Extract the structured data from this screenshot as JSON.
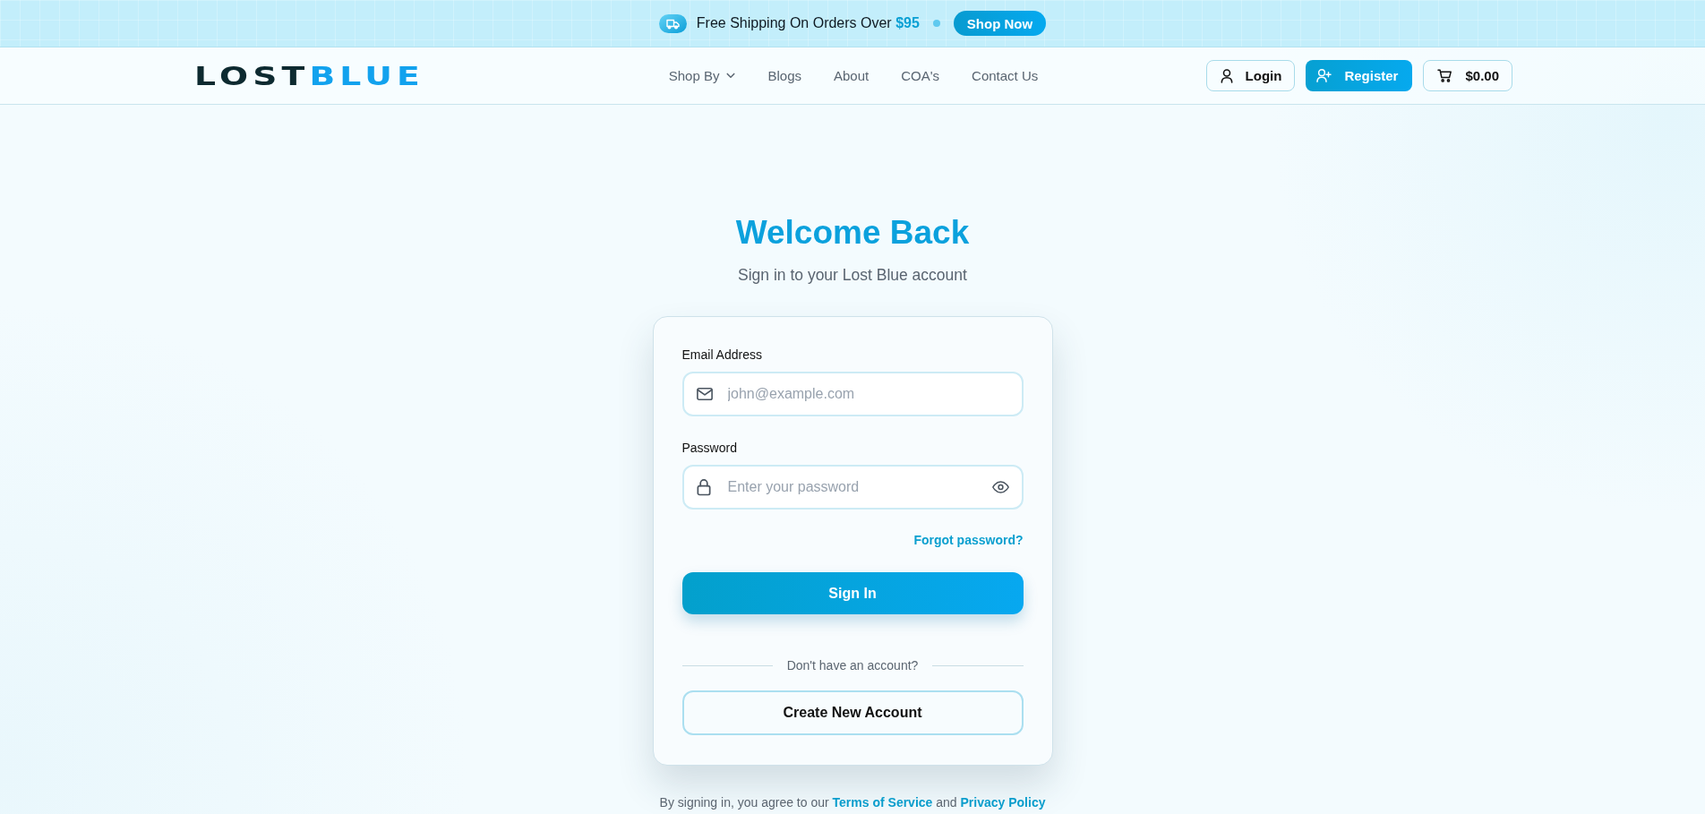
{
  "banner": {
    "message": "Free Shipping On Orders Over **$95**",
    "button": "Shop Now"
  },
  "header": {
    "logo": {
      "first": "LOST",
      "second": "BLUE"
    },
    "nav": [
      {
        "kind": "dropdown",
        "label": "Shop By"
      },
      {
        "kind": "link",
        "label": "Blogs"
      },
      {
        "kind": "link",
        "label": "About"
      },
      {
        "kind": "link",
        "label": "COA's"
      },
      {
        "kind": "link",
        "label": "Contact Us"
      }
    ],
    "login": "Login",
    "register": "Register",
    "cart_total": "$0.00"
  },
  "intro": {
    "title": "Welcome Back",
    "subtitle": "Sign in to your Lost Blue account"
  },
  "sign_in_card": {
    "fields": [
      {
        "kind": "email",
        "label": "Email Address",
        "placeholder": "john@example.com"
      },
      {
        "kind": "password",
        "label": "Password",
        "placeholder": "Enter your password"
      }
    ],
    "forgot_link": "Forgot password?",
    "submit": "Sign In",
    "divider": "Don't have an account?",
    "create_account": "Create New Account"
  },
  "legal": [
    {
      "kind": "text",
      "text": "By signing in, you agree to our"
    },
    {
      "kind": "link",
      "text": "Terms of Service"
    },
    {
      "kind": "text",
      "text": "and"
    },
    {
      "kind": "link",
      "text": "Privacy Policy"
    }
  ]
}
